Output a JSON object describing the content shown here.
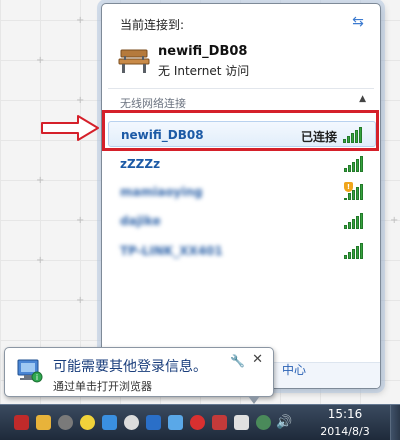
{
  "flyout": {
    "header": "当前连接到:",
    "current": {
      "name": "newifi_DB08",
      "status": "无 Internet 访问"
    },
    "section_label": "无线网络连接",
    "networks": [
      {
        "name": "newifi_DB08",
        "status": "已连接",
        "icon": "signal-strength-5"
      },
      {
        "name": "zZZZz",
        "icon": "signal-strength-5"
      },
      {
        "name": "mamiaoying",
        "icon": "signal-strength-5-shield"
      },
      {
        "name": "dajike",
        "icon": "signal-strength-5"
      },
      {
        "name": "TP-LINK_XX401",
        "icon": "signal-strength-5"
      }
    ]
  },
  "balloon": {
    "title": "可能需要其他登录信息。",
    "subtitle": "通过单击打开浏览器",
    "peek_text": "中心"
  },
  "taskbar": {
    "time": "15:16",
    "date": "2014/8/3"
  },
  "colors": {
    "highlight": "#d5202a",
    "link_blue": "#1c5aa6",
    "signal_green": "#36a33e"
  }
}
